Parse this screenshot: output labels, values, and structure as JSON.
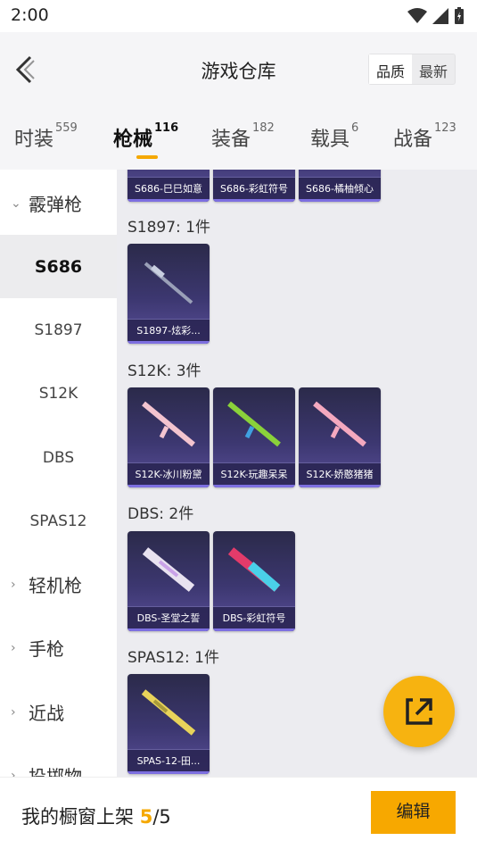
{
  "status": {
    "time": "2:00"
  },
  "header": {
    "title": "游戏仓库",
    "sort_quality": "品质",
    "sort_latest": "最新"
  },
  "tabs": [
    {
      "label": "时装",
      "count": "559"
    },
    {
      "label": "枪械",
      "count": "116"
    },
    {
      "label": "装备",
      "count": "182"
    },
    {
      "label": "载具",
      "count": "6"
    },
    {
      "label": "战备",
      "count": "123"
    }
  ],
  "sidebar": {
    "group_shotgun": "霰弹枪",
    "items": [
      "S686",
      "S1897",
      "S12K",
      "DBS",
      "SPAS12"
    ],
    "group_lmg": "轻机枪",
    "group_pistol": "手枪",
    "group_melee": "近战",
    "group_throw": "投掷物"
  },
  "sections": {
    "top_cards": [
      "S686-巳巳如意",
      "S686-彩虹符号",
      "S686-橘柚倾心"
    ],
    "s1897": {
      "title": "S1897: 1件",
      "cards": [
        "S1897-炫彩..."
      ]
    },
    "s12k": {
      "title": "S12K: 3件",
      "cards": [
        "S12K-冰川粉黛",
        "S12K-玩趣呆呆",
        "S12K-娇憨猪猪"
      ]
    },
    "dbs": {
      "title": "DBS: 2件",
      "cards": [
        "DBS-圣堂之誓",
        "DBS-彩虹符号"
      ]
    },
    "spas12": {
      "title": "SPAS12: 1件",
      "cards": [
        "SPAS-12-田..."
      ]
    }
  },
  "bottom": {
    "prefix": "我的橱窗上架 ",
    "current": "5",
    "total": "/5",
    "edit_label": "编辑"
  },
  "colors": {
    "accent": "#f7a800",
    "card_bg": "#3c3770"
  }
}
